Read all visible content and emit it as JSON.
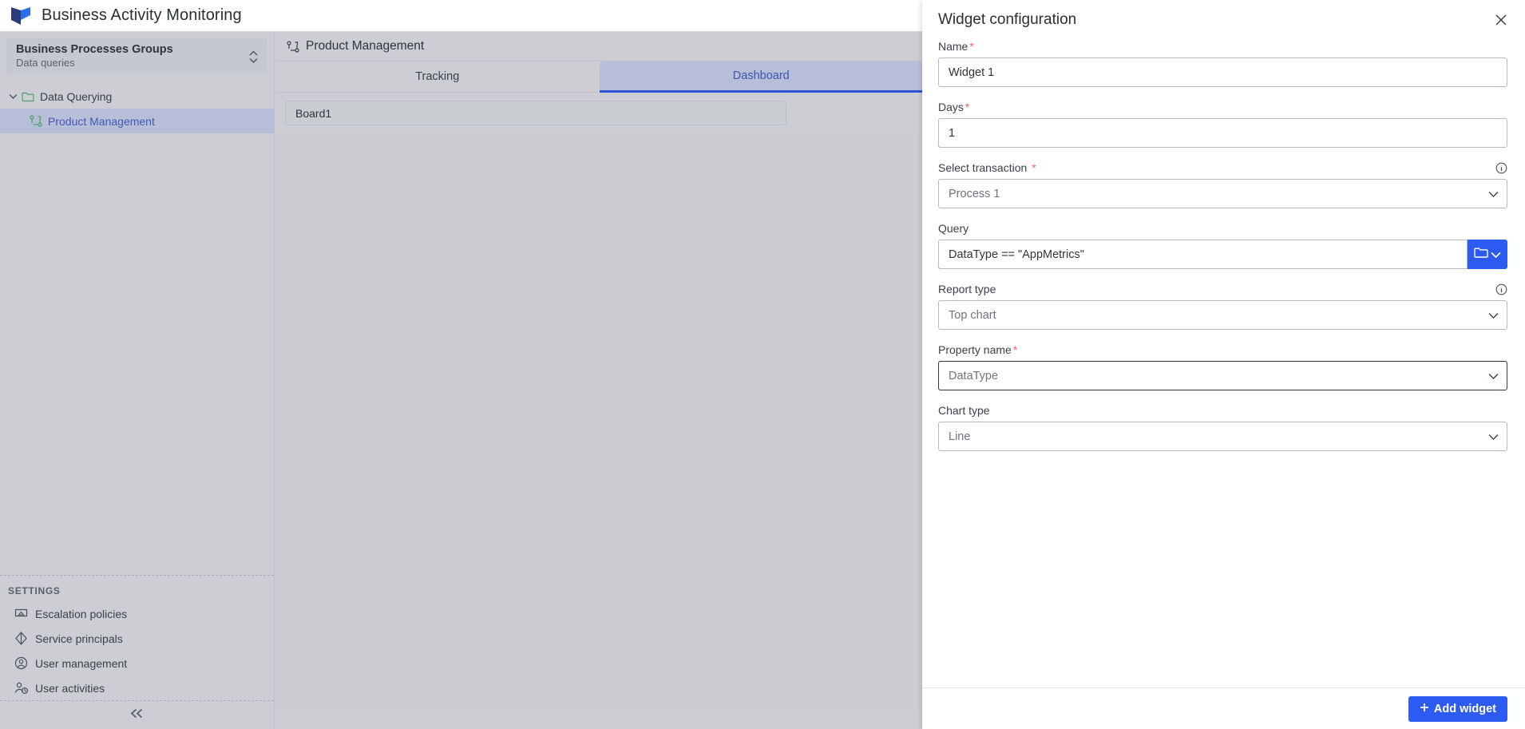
{
  "app": {
    "title": "Business Activity Monitoring",
    "logo_icon": "bam-logo-icon"
  },
  "sidebar": {
    "group": {
      "title": "Business Processes Groups",
      "subtitle": "Data queries",
      "caret_icon": "chevron-up-down-icon"
    },
    "tree": [
      {
        "label": "Data Querying",
        "icon": "folder-icon",
        "twisty_icon": "chevron-down-icon",
        "selected": false
      },
      {
        "label": "Product Management",
        "icon": "process-icon",
        "selected": true
      }
    ],
    "settings": {
      "title": "SETTINGS",
      "items": [
        {
          "label": "Escalation policies",
          "icon": "escalation-icon"
        },
        {
          "label": "Service principals",
          "icon": "service-principal-icon"
        },
        {
          "label": "User management",
          "icon": "user-circle-icon"
        },
        {
          "label": "User activities",
          "icon": "user-clock-icon"
        }
      ]
    },
    "collapse_icon": "double-chevron-left-icon"
  },
  "main": {
    "title": "Product Management",
    "title_icon": "process-icon",
    "tabs": [
      {
        "label": "Tracking",
        "active": false
      },
      {
        "label": "Dashboard",
        "active": true
      }
    ],
    "board": {
      "label": "Board1"
    }
  },
  "panel": {
    "title": "Widget configuration",
    "close_icon": "close-icon",
    "fields": {
      "name": {
        "label": "Name",
        "required": true,
        "value": "Widget 1"
      },
      "days": {
        "label": "Days",
        "required": true,
        "value": "1"
      },
      "transaction": {
        "label": "Select transaction",
        "required": true,
        "value": "Process 1",
        "info_icon": "info-icon",
        "chevron_icon": "chevron-down-icon"
      },
      "query": {
        "label": "Query",
        "required": false,
        "value": "DataType == \"AppMetrics\"",
        "button_icons": [
          "folder-icon",
          "chevron-down-icon"
        ]
      },
      "report_type": {
        "label": "Report type",
        "required": false,
        "value": "Top chart",
        "info_icon": "info-icon",
        "chevron_icon": "chevron-down-icon"
      },
      "property_name": {
        "label": "Property name",
        "required": true,
        "value": "DataType",
        "chevron_icon": "chevron-down-icon",
        "focused": true
      },
      "chart_type": {
        "label": "Chart type",
        "required": false,
        "value": "Line",
        "chevron_icon": "chevron-down-icon"
      }
    },
    "footer": {
      "add_widget_label": "Add widget",
      "add_icon": "plus-icon"
    }
  },
  "colors": {
    "accent": "#2c5bf2",
    "tab_active_bg": "#b7bfd8",
    "tab_active_text": "#3f51b5",
    "required_mark": "#f2635f",
    "sidebar_bg": "#ccced3"
  }
}
